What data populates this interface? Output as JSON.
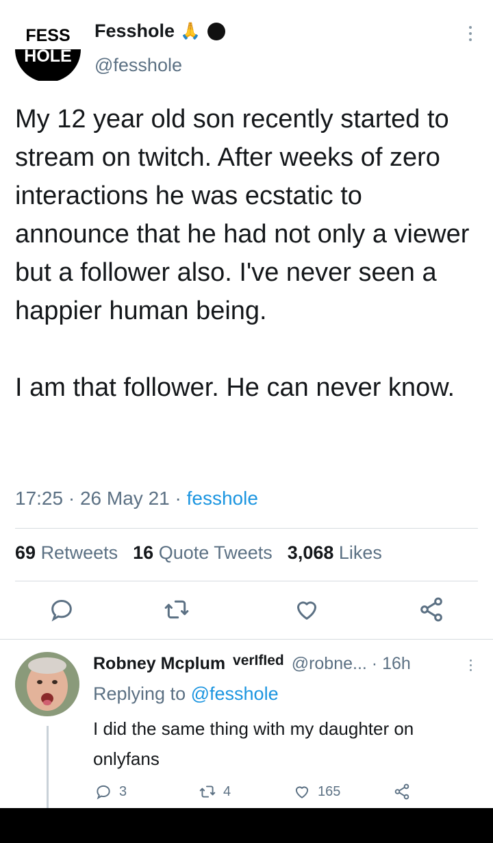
{
  "tweet": {
    "display_name": "Fesshole",
    "name_emoji": "🙏",
    "handle": "@fesshole",
    "logo_text_top": "FESS",
    "logo_text_bottom": "HOLE",
    "text": "My 12 year old son recently started to stream on twitch. After weeks of zero interactions he was ecstatic to announce that he had not only a viewer but a follower also. I've never seen a happier human being.\n\nI am that follower. He can never know.",
    "time": "17:25",
    "separator": "·",
    "date": "26 May 21",
    "source": "fesshole"
  },
  "stats": {
    "retweets_count": "69",
    "retweets_label": "Retweets",
    "quotes_count": "16",
    "quotes_label": "Quote Tweets",
    "likes_count": "3,068",
    "likes_label": "Likes"
  },
  "icons": {
    "reply": "speech-bubble",
    "retweet": "retweet-arrows",
    "like": "heart",
    "share": "share-nodes",
    "more": "vertical-ellipsis"
  },
  "reply": {
    "name": "Robney Mcplum",
    "verified_label": "verIfIed",
    "handle": "@robne...",
    "separator": "·",
    "time": "16h",
    "replying_prefix": "Replying to",
    "replying_to": "@fesshole",
    "text": "I did the same thing with my daughter on onlyfans",
    "reply_count": "3",
    "retweet_count": "4",
    "like_count": "165"
  },
  "colors": {
    "accent": "#1b95e0",
    "secondary_text": "#5b7083",
    "primary_text": "#14171a",
    "divider": "#d6dbdf"
  }
}
